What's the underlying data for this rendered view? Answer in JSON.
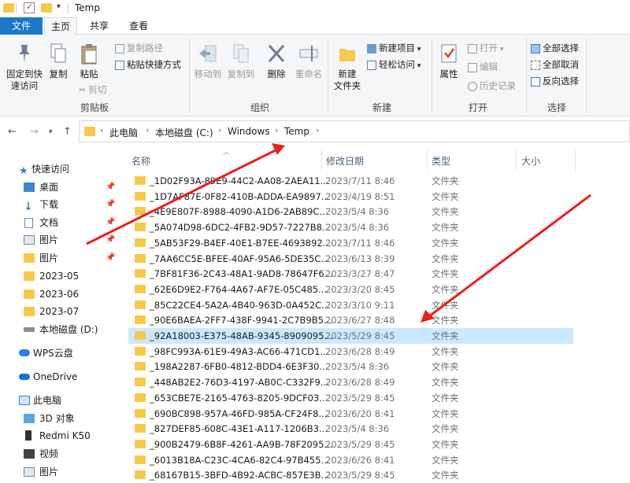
{
  "window": {
    "title": "Temp"
  },
  "tabs": [
    {
      "label": "文件"
    },
    {
      "label": "主页"
    },
    {
      "label": "共享"
    },
    {
      "label": "查看"
    }
  ],
  "ribbon": {
    "clipboard": {
      "pin_label_1": "固定到快",
      "pin_label_2": "速访问",
      "copy_label": "复制",
      "paste_label": "粘贴",
      "copy_path_label": "复制路径",
      "paste_shortcut_label": "粘贴快捷方式",
      "cut_label": "剪切",
      "group_label": "剪贴板"
    },
    "organize": {
      "move_to_label": "移动到",
      "copy_to_label": "复制到",
      "delete_label": "删除",
      "rename_label": "重命名",
      "group_label": "组织"
    },
    "new": {
      "new_folder_label_1": "新建",
      "new_folder_label_2": "文件夹",
      "new_item_label": "新建项目",
      "easy_access_label": "轻松访问",
      "group_label": "新建"
    },
    "open": {
      "properties_label": "属性",
      "open_label": "打开",
      "edit_label": "编辑",
      "history_label": "历史记录",
      "group_label": "打开"
    },
    "select": {
      "select_all_label": "全部选择",
      "select_none_label": "全部取消",
      "invert_label": "反向选择",
      "group_label": "选择"
    }
  },
  "address": {
    "crumbs": [
      "此电脑",
      "本地磁盘 (C:)",
      "Windows",
      "Temp"
    ]
  },
  "sidebar": {
    "items": [
      {
        "label": "快速访问",
        "icon": "star-icon"
      },
      {
        "label": "桌面",
        "icon": "desktop-icon"
      },
      {
        "label": "下载",
        "icon": "download-icon"
      },
      {
        "label": "文档",
        "icon": "document-icon"
      },
      {
        "label": "图片",
        "icon": "picture-icon"
      },
      {
        "label": "图片",
        "icon": "folder-icon"
      },
      {
        "label": "2023-05",
        "icon": "folder-icon"
      },
      {
        "label": "2023-06",
        "icon": "folder-icon"
      },
      {
        "label": "2023-07",
        "icon": "folder-icon"
      },
      {
        "label": "本地磁盘 (D:)",
        "icon": "drive-icon"
      },
      {
        "label": "WPS云盘",
        "icon": "cloud-icon"
      },
      {
        "label": "OneDrive",
        "icon": "onedrive-icon"
      },
      {
        "label": "此电脑",
        "icon": "computer-icon"
      },
      {
        "label": "3D 对象",
        "icon": "cube-icon"
      },
      {
        "label": "Redmi K50",
        "icon": "phone-icon"
      },
      {
        "label": "视频",
        "icon": "video-icon"
      },
      {
        "label": "图片",
        "icon": "picture-icon"
      }
    ]
  },
  "columns": {
    "name": "名称",
    "date": "修改日期",
    "type": "类型",
    "size": "大小"
  },
  "files": [
    {
      "name": "_1D02F93A-89E9-44C2-AA08-2AEA11...",
      "date": "2023/7/11 8:46",
      "type": "文件夹"
    },
    {
      "name": "_1D7AF87E-0F82-410B-ADDA-EA9897...",
      "date": "2023/4/19 8:51",
      "type": "文件夹"
    },
    {
      "name": "_4E9E807F-8988-4090-A1D6-2AB89C...",
      "date": "2023/5/4 8:36",
      "type": "文件夹"
    },
    {
      "name": "_5A074D98-6DC2-4FB2-9D57-7227B8...",
      "date": "2023/5/4 8:36",
      "type": "文件夹"
    },
    {
      "name": "_5AB53F29-B4EF-40E1-B7EE-4693892...",
      "date": "2023/7/11 8:46",
      "type": "文件夹"
    },
    {
      "name": "_7AA6CC5E-BFEE-40AF-95A6-5DE35C...",
      "date": "2023/6/13 8:39",
      "type": "文件夹"
    },
    {
      "name": "_7BF81F36-2C43-48A1-9AD8-78647F6...",
      "date": "2023/3/27 8:47",
      "type": "文件夹"
    },
    {
      "name": "_62E6D9E2-F764-4A67-AF7E-05C485...",
      "date": "2023/3/20 8:45",
      "type": "文件夹"
    },
    {
      "name": "_85C22CE4-5A2A-4B40-963D-0A452C...",
      "date": "2023/3/10 9:11",
      "type": "文件夹"
    },
    {
      "name": "_90E6BAEA-2FF7-438F-9941-2C7B9B5...",
      "date": "2023/6/27 8:48",
      "type": "文件夹"
    },
    {
      "name": "_92A18003-E375-48AB-9345-8909095...",
      "date": "2023/5/29 8:45",
      "type": "文件夹"
    },
    {
      "name": "_98FC993A-61E9-49A3-AC66-471CD1...",
      "date": "2023/6/28 8:49",
      "type": "文件夹"
    },
    {
      "name": "_198A2287-6FB0-4812-BDD4-6E3F30...",
      "date": "2023/5/4 8:36",
      "type": "文件夹"
    },
    {
      "name": "_448AB2E2-76D3-4197-AB0C-C332F9...",
      "date": "2023/6/28 8:49",
      "type": "文件夹"
    },
    {
      "name": "_653CBE7E-2165-4763-8205-9DCF03...",
      "date": "2023/5/29 8:45",
      "type": "文件夹"
    },
    {
      "name": "_690BC898-957A-46FD-985A-CF24F8...",
      "date": "2023/6/20 8:41",
      "type": "文件夹"
    },
    {
      "name": "_827DEF85-608C-43E1-A117-1206B3...",
      "date": "2023/5/4 8:36",
      "type": "文件夹"
    },
    {
      "name": "_900B2479-6B8F-4261-AA9B-78F2095...",
      "date": "2023/5/29 8:45",
      "type": "文件夹"
    },
    {
      "name": "_6013B18A-C23C-4CA6-82C4-97B455...",
      "date": "2023/6/26 8:41",
      "type": "文件夹"
    },
    {
      "name": "_68167B15-3BFD-4B92-ACBC-857E3B...",
      "date": "2023/5/29 8:45",
      "type": "文件夹"
    }
  ],
  "colors": {
    "accent": "#1979ca",
    "folder": "#f7c94a",
    "selected_row": "#cce8ff",
    "annotation_arrow": "#e8211b"
  }
}
